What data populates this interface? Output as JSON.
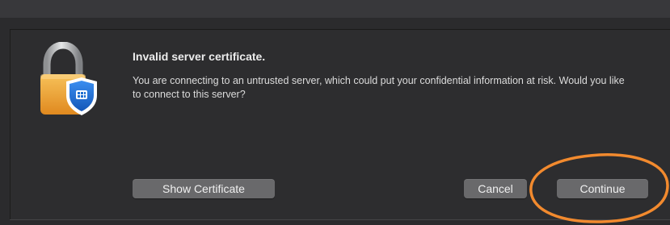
{
  "dialog": {
    "icon": "lock-shield-icon",
    "title": "Invalid server certificate.",
    "message": "You are connecting to an untrusted server, which could put your confidential information at risk. Would you like to connect to this server?"
  },
  "buttons": {
    "show_certificate": "Show Certificate",
    "cancel": "Cancel",
    "continue": "Continue"
  },
  "annotation": {
    "type": "circle-highlight",
    "target": "continue-button",
    "color": "#f28a2e"
  },
  "colors": {
    "background": "#2d2d2f",
    "button": "#69696b",
    "lock_body": "#f1a93a",
    "shield": "#1f6fd1"
  }
}
